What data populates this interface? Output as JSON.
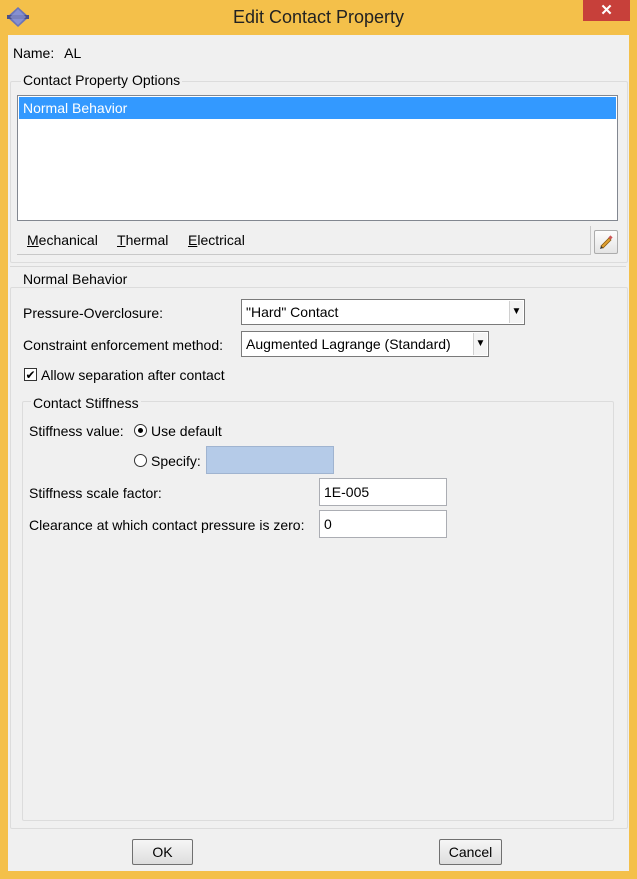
{
  "window": {
    "title": "Edit Contact Property",
    "close_label": "✕",
    "app_icon": "abaqus-icon"
  },
  "name": {
    "label": "Name:",
    "value": "AL"
  },
  "options": {
    "legend": "Contact Property Options",
    "items": [
      "Normal Behavior"
    ],
    "selected": "Normal Behavior"
  },
  "menu": [
    {
      "mnemonic": "M",
      "rest": "echanical"
    },
    {
      "mnemonic": "T",
      "rest": "hermal"
    },
    {
      "mnemonic": "E",
      "rest": "lectrical"
    }
  ],
  "edit_icon": "pencil-icon",
  "normal": {
    "legend": "Normal Behavior",
    "pressure_label": "Pressure-Overclosure:",
    "pressure_value": "\"Hard\" Contact",
    "constraint_label": "Constraint enforcement method:",
    "constraint_value": "Augmented Lagrange (Standard)",
    "allow_sep_label": "Allow separation after contact",
    "allow_sep_checked": true
  },
  "stiffness": {
    "legend": "Contact Stiffness",
    "value_label": "Stiffness value:",
    "use_default_label": "Use default",
    "specify_label": "Specify:",
    "specify_value": "",
    "scale_label": "Stiffness scale factor:",
    "scale_value": "1E-005",
    "clearance_label": "Clearance at which contact pressure is zero:",
    "clearance_value": "0"
  },
  "buttons": {
    "ok": "OK",
    "cancel": "Cancel"
  }
}
